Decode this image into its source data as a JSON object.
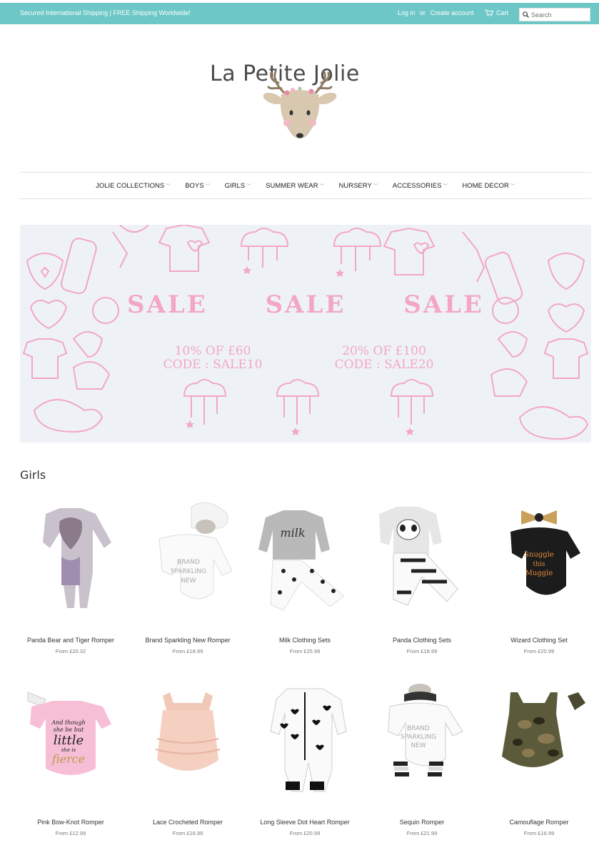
{
  "topbar": {
    "promo": "Secured International Shipping | FREE Shipping Worldwide!",
    "login": "Log in",
    "or": "or",
    "create_account": "Create account",
    "cart": "Cart",
    "search_placeholder": "Search"
  },
  "logo": {
    "text": "La Petite Jolie"
  },
  "nav": [
    "JOLIE COLLECTIONS",
    "BOYS",
    "GIRLS",
    "SUMMER WEAR",
    "NURSERY",
    "ACCESSORIES",
    "HOME DECOR"
  ],
  "banner": {
    "headline": [
      "SALE",
      "SALE",
      "SALE"
    ],
    "offer1": "10% OF £60",
    "code1": "CODE : SALE10",
    "offer2": "20% OF £100",
    "code2": "CODE : SALE20"
  },
  "section_title": "Girls",
  "products": [
    {
      "name": "Panda Bear and Tiger Romper",
      "price": "From £20.32"
    },
    {
      "name": "Brand Sparkling New Romper",
      "price": "From £18.99"
    },
    {
      "name": "Milk Clothing Sets",
      "price": "From £25.99"
    },
    {
      "name": "Panda Clothing Sets",
      "price": "From £18.99"
    },
    {
      "name": "Wizard Clothing Set",
      "price": "From £20.99"
    },
    {
      "name": "Pink Bow-Knot Romper",
      "price": "From £12.99"
    },
    {
      "name": "Lace Crocheted Romper",
      "price": "From £16.99"
    },
    {
      "name": "Long Sleeve Dot Heart Romper",
      "price": "From £20.99"
    },
    {
      "name": "Sequin Romper",
      "price": "From £21.99"
    },
    {
      "name": "Camouflage Romper",
      "price": "From £16.99"
    }
  ],
  "product_images": {
    "milk_text": "milk",
    "brand_text": [
      "BRAND",
      "SPARKLING",
      "NEW"
    ],
    "wizard_text": [
      "Snuggle",
      "this",
      "Muggle"
    ],
    "little_text": [
      "And though",
      "she be but",
      "little",
      "she is",
      "fierce"
    ]
  },
  "colors": {
    "topbar": "#6ec7c7",
    "banner_bg": "#eef2f6",
    "banner_pink": "#f3a6c8"
  }
}
